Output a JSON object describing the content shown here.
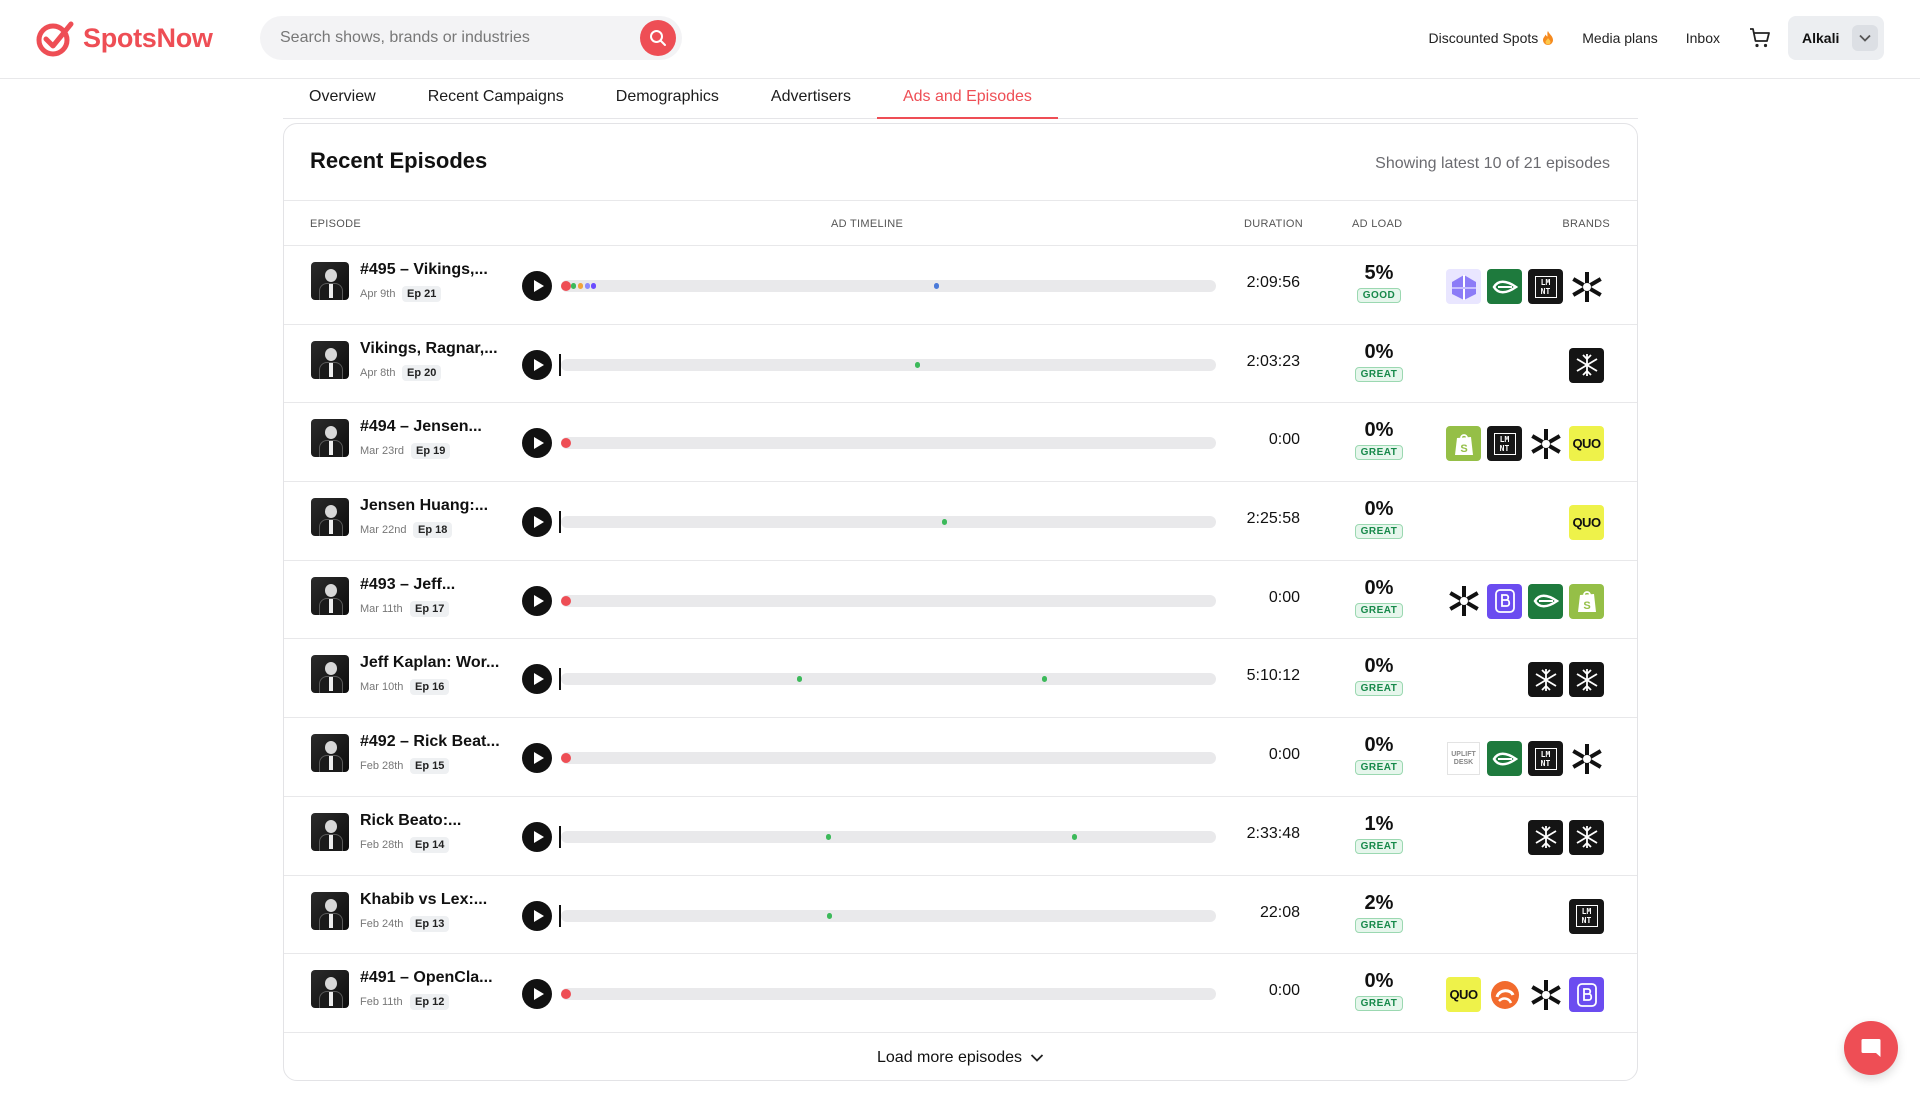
{
  "app": {
    "name": "SpotsNow"
  },
  "search": {
    "placeholder": "Search shows, brands or industries"
  },
  "nav": {
    "discounted_spots": "Discounted Spots",
    "discounted_icon": "fire-icon",
    "media_plans": "Media plans",
    "inbox": "Inbox",
    "user": "Alkali"
  },
  "tabs": [
    "Overview",
    "Recent Campaigns",
    "Demographics",
    "Advertisers",
    "Ads and Episodes"
  ],
  "active_tab": "Ads and Episodes",
  "card": {
    "title": "Recent Episodes",
    "subtitle": "Showing latest 10 of 21 episodes",
    "columns": {
      "episode": "EPISODE",
      "timeline": "AD TIMELINE",
      "duration": "DURATION",
      "adload": "AD LOAD",
      "brands": "BRANDS"
    },
    "load_more": "Load more episodes"
  },
  "colors": {
    "accent": "#ee4e55",
    "great_green": "#17894a"
  },
  "episodes": [
    {
      "title": "#495 – Vikings,...",
      "date": "Apr 9th",
      "ep": "Ep 21",
      "duration": "2:09:56",
      "adload": "5%",
      "rating": "GOOD",
      "start_red": true,
      "marks": [
        {
          "pos": 0.016,
          "color": "#3cb95a"
        },
        {
          "pos": 0.026,
          "color": "#f2a33a"
        },
        {
          "pos": 0.036,
          "color": "#8a8aff"
        },
        {
          "pos": 0.046,
          "color": "#6a4cff"
        },
        {
          "pos": 0.57,
          "color": "#4a7ad9"
        }
      ],
      "brands": [
        "lattice",
        "leaf",
        "lmnt",
        "asterisk"
      ]
    },
    {
      "title": "Vikings, Ragnar,...",
      "date": "Apr 8th",
      "ep": "Ep 20",
      "duration": "2:03:23",
      "adload": "0%",
      "rating": "GREAT",
      "start_red": false,
      "marks": [
        {
          "pos": 0.54,
          "color": "#3cb95a"
        }
      ],
      "brands": [
        "snowflake"
      ]
    },
    {
      "title": "#494 – Jensen...",
      "date": "Mar 23rd",
      "ep": "Ep 19",
      "duration": "0:00",
      "adload": "0%",
      "rating": "GREAT",
      "start_red": true,
      "marks": [],
      "brands": [
        "shopify",
        "lmnt",
        "asterisk",
        "quo"
      ]
    },
    {
      "title": "Jensen Huang:...",
      "date": "Mar 22nd",
      "ep": "Ep 18",
      "duration": "2:25:58",
      "adload": "0%",
      "rating": "GREAT",
      "start_red": false,
      "marks": [
        {
          "pos": 0.582,
          "color": "#3cb95a"
        }
      ],
      "brands": [
        "quo"
      ]
    },
    {
      "title": "#493 – Jeff...",
      "date": "Mar 11th",
      "ep": "Ep 17",
      "duration": "0:00",
      "adload": "0%",
      "rating": "GREAT",
      "start_red": true,
      "marks": [],
      "brands": [
        "asterisk",
        "bpurple",
        "leaf",
        "shopify"
      ]
    },
    {
      "title": "Jeff Kaplan: Wor...",
      "date": "Mar 10th",
      "ep": "Ep 16",
      "duration": "5:10:12",
      "adload": "0%",
      "rating": "GREAT",
      "start_red": false,
      "marks": [
        {
          "pos": 0.36,
          "color": "#3cb95a"
        },
        {
          "pos": 0.735,
          "color": "#3cb95a"
        }
      ],
      "brands": [
        "snowflake",
        "snowflake"
      ]
    },
    {
      "title": "#492 – Rick Beat...",
      "date": "Feb 28th",
      "ep": "Ep 15",
      "duration": "0:00",
      "adload": "0%",
      "rating": "GREAT",
      "start_red": true,
      "marks": [],
      "brands": [
        "upliftdesk",
        "leaf",
        "lmnt",
        "asterisk"
      ]
    },
    {
      "title": "Rick Beato:...",
      "date": "Feb 28th",
      "ep": "Ep 14",
      "duration": "2:33:48",
      "adload": "1%",
      "rating": "GREAT",
      "start_red": false,
      "marks": [
        {
          "pos": 0.405,
          "color": "#3cb95a"
        },
        {
          "pos": 0.78,
          "color": "#3cb95a"
        }
      ],
      "brands": [
        "snowflake",
        "snowflake"
      ]
    },
    {
      "title": "Khabib vs Lex:...",
      "date": "Feb 24th",
      "ep": "Ep 13",
      "duration": "22:08",
      "adload": "2%",
      "rating": "GREAT",
      "start_red": false,
      "marks": [
        {
          "pos": 0.406,
          "color": "#3cb95a"
        }
      ],
      "brands": [
        "lmnt"
      ]
    },
    {
      "title": "#491 – OpenCla...",
      "date": "Feb 11th",
      "ep": "Ep 12",
      "duration": "0:00",
      "adload": "0%",
      "rating": "GREAT",
      "start_red": true,
      "marks": [],
      "brands": [
        "quo",
        "orange",
        "asterisk",
        "bpurple"
      ]
    }
  ],
  "brand_icons": {
    "lattice": "lattice-brand-icon",
    "leaf": "leaf-brand-icon",
    "lmnt": "lmnt-brand-icon",
    "asterisk": "asterisk-brand-icon",
    "snowflake": "snowflake-brand-icon",
    "shopify": "shopify-brand-icon",
    "quo": "quo-brand-icon",
    "bpurple": "b-brand-icon",
    "upliftdesk": "uplift-desk-brand-icon",
    "orange": "orange-swirl-brand-icon"
  },
  "brand_text": {
    "quo": "QUO",
    "lmnt": "LM NT",
    "upliftdesk": "UPLIFT DESK"
  }
}
